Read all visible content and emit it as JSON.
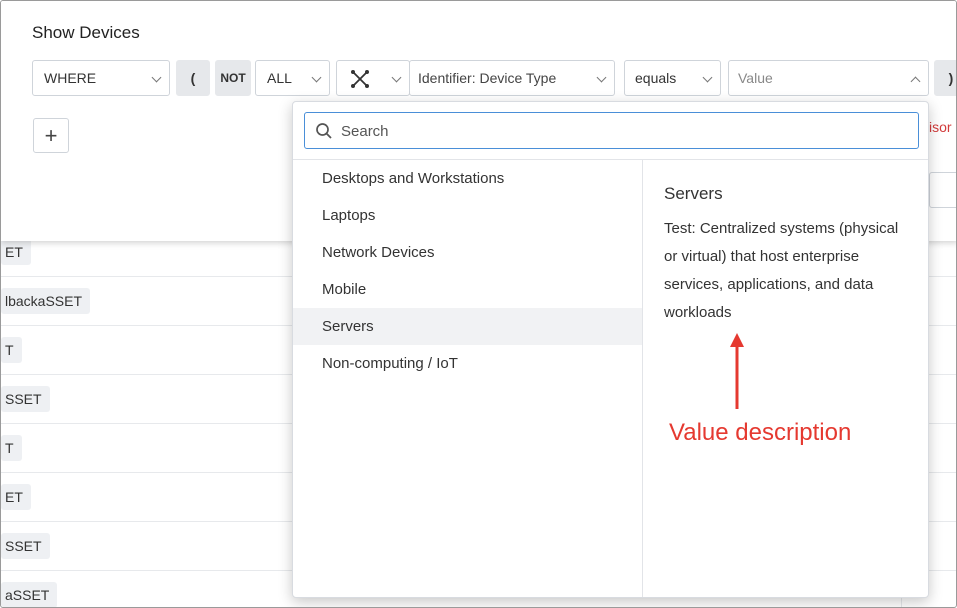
{
  "panel": {
    "title": "Show Devices",
    "where_select": "WHERE",
    "open_paren": "(",
    "not_toggle": "NOT",
    "all_select": "ALL",
    "icon_select_icon": "scatter-network-icon",
    "field_select": "Identifier: Device Type",
    "operator_select": "equals",
    "value_placeholder": "Value",
    "close_paren": ")",
    "add_button": "+",
    "cut_text": "isor"
  },
  "rows": [
    {
      "label": "ET"
    },
    {
      "label": "lbackaSSET"
    },
    {
      "label": "T"
    },
    {
      "label": "SSET"
    },
    {
      "label": "T"
    },
    {
      "label": "ET"
    },
    {
      "label": "SSET"
    },
    {
      "label": "aSSET"
    }
  ],
  "dropdown": {
    "search_placeholder": "Search",
    "options": [
      {
        "label": "Desktops and Workstations"
      },
      {
        "label": "Laptops"
      },
      {
        "label": "Network Devices"
      },
      {
        "label": "Mobile"
      },
      {
        "label": "Servers",
        "selected": true
      },
      {
        "label": "Non-computing / IoT"
      }
    ],
    "description_title": "Servers",
    "description_body": "Test: Centralized systems (physical or virtual) that host enterprise services, applications, and data workloads"
  },
  "annotation": {
    "text": "Value description",
    "color": "#e53930"
  }
}
